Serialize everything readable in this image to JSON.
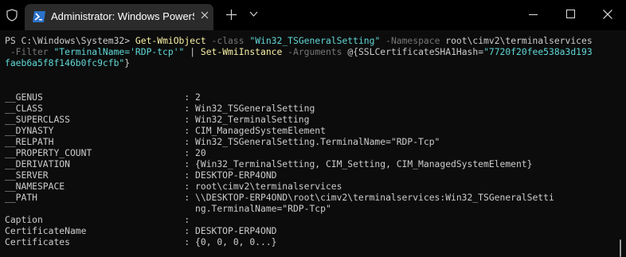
{
  "tab": {
    "title": "Administrator: Windows PowerShell",
    "close_icon": "close-icon"
  },
  "titlebar": {
    "shield_icon": "shield-icon",
    "new_tab_icon": "plus-icon",
    "dropdown_icon": "chevron-down-icon",
    "minimize_icon": "minimize-icon",
    "maximize_icon": "maximize-icon",
    "close_icon": "close-icon"
  },
  "console": {
    "cmd1": {
      "prompt": "PS C:\\Windows\\System32> ",
      "cmdlet": "Get-WmiObject",
      "p_class": " -class ",
      "v_class": "\"Win32_TSGeneralSetting\"",
      "p_ns": " -Namespace ",
      "v_ns": "root\\cimv2\\terminalservices"
    },
    "cmd2": {
      "p_filter": " -Filter ",
      "v_filter": "\"TerminalName='RDP-tcp'\"",
      "pipe": " | ",
      "cmdlet2": "Set-WmiInstance",
      "p_args": " -Arguments ",
      "args_open": "@{SSLCertificateSHA1Hash=",
      "hash_start": "\"7720f20fee538a3d193"
    },
    "cmd3": {
      "hash_end": "faeb6a5f8f146b0fc9cfb\"",
      "close": "}"
    },
    "output": [
      "__GENUS                          : 2",
      "__CLASS                          : Win32_TSGeneralSetting",
      "__SUPERCLASS                     : Win32_TerminalSetting",
      "__DYNASTY                        : CIM_ManagedSystemElement",
      "__RELPATH                        : Win32_TSGeneralSetting.TerminalName=\"RDP-Tcp\"",
      "__PROPERTY_COUNT                 : 20",
      "__DERIVATION                     : {Win32_TerminalSetting, CIM_Setting, CIM_ManagedSystemElement}",
      "__SERVER                         : DESKTOP-ERP4OND",
      "__NAMESPACE                      : root\\cimv2\\terminalservices",
      "__PATH                           : \\\\DESKTOP-ERP4OND\\root\\cimv2\\terminalservices:Win32_TSGeneralSetti",
      "                                   ng.TerminalName=\"RDP-Tcp\"",
      "Caption                          :",
      "CertificateName                  : DESKTOP-ERP4OND",
      "Certificates                     : {0, 0, 0, 0...}"
    ]
  },
  "colors": {
    "background": "#0c0c0c",
    "text": "#cccccc",
    "cmdlet": "#f9f1a5",
    "parameter": "#767676",
    "string": "#61d6d6"
  }
}
